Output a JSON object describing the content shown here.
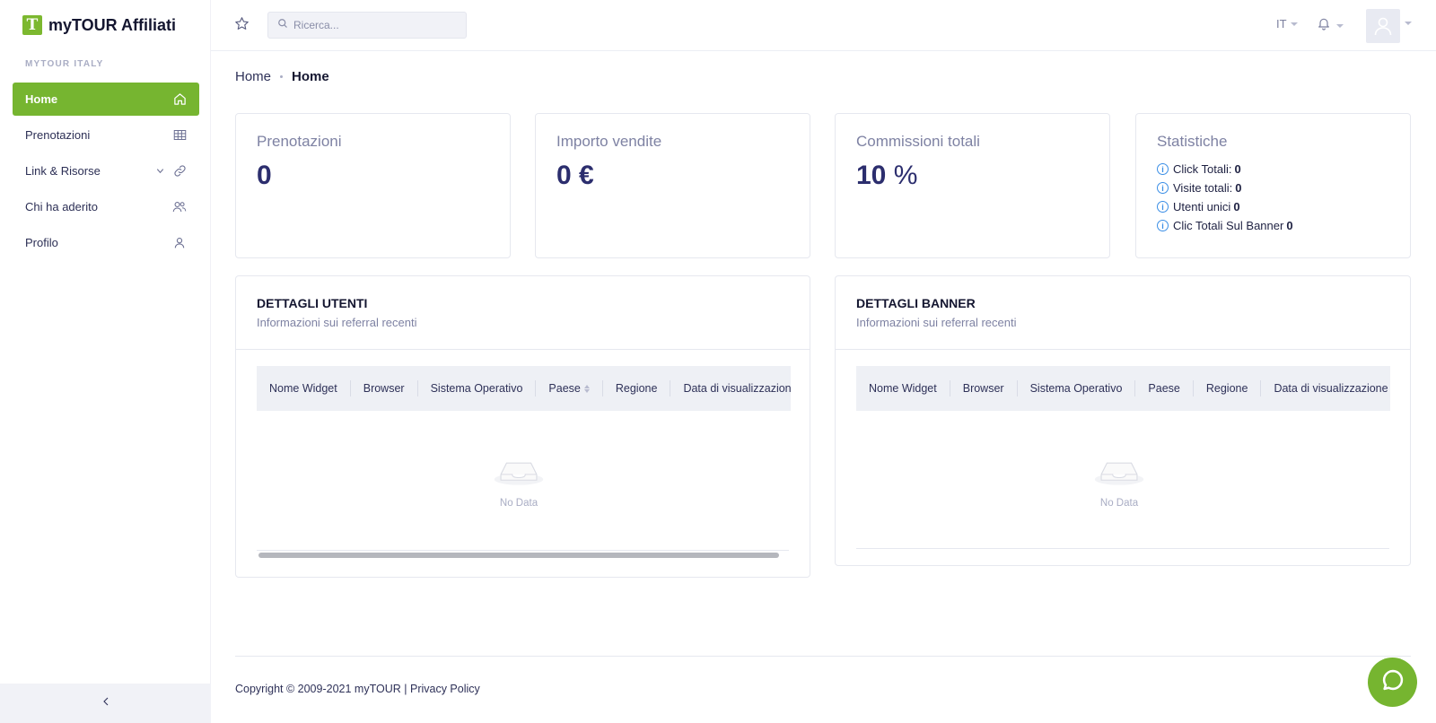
{
  "brand": {
    "logo_letter": "T",
    "name": "myTOUR Affiliati"
  },
  "sidebar": {
    "section_label": "MYTOUR ITALY",
    "items": [
      {
        "label": "Home",
        "icon": "home-icon",
        "active": true
      },
      {
        "label": "Prenotazioni",
        "icon": "table-icon",
        "active": false
      },
      {
        "label": "Link & Risorse",
        "icon": "link-icon",
        "active": false
      },
      {
        "label": "Chi ha aderito",
        "icon": "users-icon",
        "active": false
      },
      {
        "label": "Profilo",
        "icon": "user-icon",
        "active": false
      }
    ]
  },
  "header": {
    "search_placeholder": "Ricerca...",
    "language": "IT"
  },
  "breadcrumb": {
    "root": "Home",
    "current": "Home"
  },
  "stats": {
    "bookings": {
      "title": "Prenotazioni",
      "value": "0"
    },
    "sales": {
      "title": "Importo vendite",
      "value": "0",
      "unit": "€"
    },
    "commissions": {
      "title": "Commissioni totali",
      "value": "10",
      "unit": "%"
    },
    "statistics": {
      "title": "Statistiche",
      "items": [
        {
          "label": "Click Totali:",
          "value": "0"
        },
        {
          "label": "Visite totali:",
          "value": "0"
        },
        {
          "label": "Utenti unici",
          "value": "0"
        },
        {
          "label": "Clic Totali Sul Banner",
          "value": "0"
        }
      ]
    }
  },
  "users_table": {
    "title": "DETTAGLI UTENTI",
    "subtitle": "Informazioni sui referral recenti",
    "columns": [
      "Nome Widget",
      "Browser",
      "Sistema Operativo",
      "Paese",
      "Regione",
      "Data di visualizzazione"
    ],
    "empty_text": "No Data"
  },
  "banner_table": {
    "title": "DETTAGLI BANNER",
    "subtitle": "Informazioni sui referral recenti",
    "columns": [
      "Nome Widget",
      "Browser",
      "Sistema Operativo",
      "Paese",
      "Regione",
      "Data di visualizzazione"
    ],
    "empty_text": "No Data"
  },
  "footer": {
    "copyright": "Copyright © 2009-2021 myTOUR",
    "separator": "|",
    "privacy_link": "Privacy Policy"
  },
  "colors": {
    "accent": "#76b530",
    "primary_text": "#2c2e6e",
    "muted": "#7e82a3",
    "info": "#3a8ee6"
  }
}
